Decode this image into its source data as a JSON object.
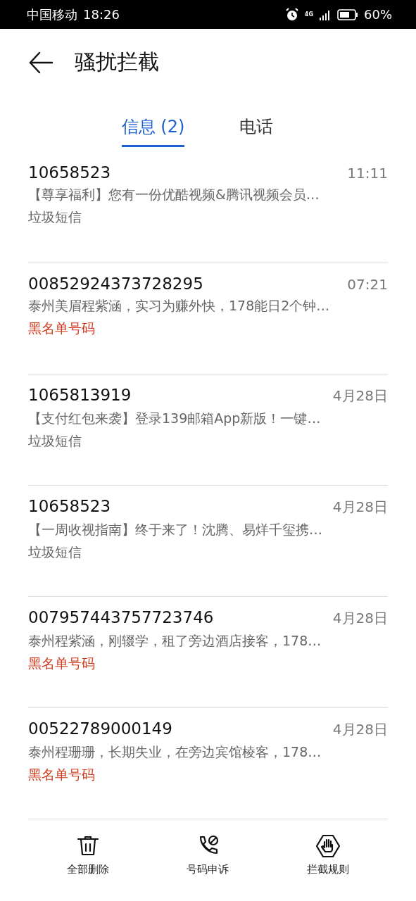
{
  "status_bar": {
    "carrier": "中国移动",
    "time": "18:26",
    "network": "4G",
    "battery": "60%"
  },
  "header": {
    "title": "骚扰拦截"
  },
  "tabs": [
    {
      "label": "信息 (2)",
      "selected": true
    },
    {
      "label": "电话",
      "selected": false
    }
  ],
  "messages": [
    {
      "sender": "10658523",
      "time": "11:11",
      "preview": "【尊享福利】您有一份优酷视频&腾讯视频会员…",
      "tag": "垃圾短信",
      "kind": "spam"
    },
    {
      "sender": "00852924373728295",
      "time": "07:21",
      "preview": "泰州美眉程紫涵，实习为赚外快，178能日2个钟…",
      "tag": "黑名单号码",
      "kind": "blacklist"
    },
    {
      "sender": "1065813919",
      "time": "4月28日",
      "preview": "【支付红包来袭】登录139邮箱App新版！一键…",
      "tag": "垃圾短信",
      "kind": "spam"
    },
    {
      "sender": "10658523",
      "time": "4月28日",
      "preview": "【一周收视指南】终于来了！沈腾、易烊千玺携…",
      "tag": "垃圾短信",
      "kind": "spam"
    },
    {
      "sender": "007957443757723746",
      "time": "4月28日",
      "preview": "泰州程紫涵，刚辍学，租了旁边酒店接客，178…",
      "tag": "黑名单号码",
      "kind": "blacklist"
    },
    {
      "sender": "00522789000149",
      "time": "4月28日",
      "preview": "泰州程珊珊，长期失业，在旁边宾馆棱客，178…",
      "tag": "黑名单号码",
      "kind": "blacklist"
    }
  ],
  "toolbar": [
    {
      "label": "全部删除",
      "kind": "delete"
    },
    {
      "label": "号码申诉",
      "kind": "appeal"
    },
    {
      "label": "拦截规则",
      "kind": "rules"
    }
  ]
}
